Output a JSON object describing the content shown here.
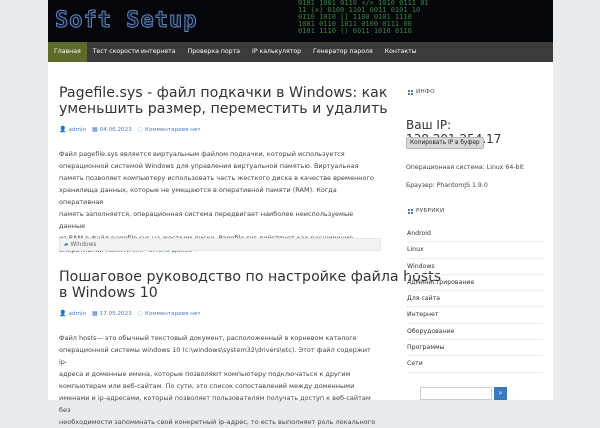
{
  "site": {
    "logo_text": "Soft Setup"
  },
  "nav": {
    "items": [
      "Главная",
      "Тест скорости интернета",
      "Проверка порта",
      "IP калькулятор",
      "Генератор пароля",
      "Контакты"
    ]
  },
  "posts": [
    {
      "title_line1": "Pagefile.sys - файл подкачки в Windows: как",
      "title_line2": "уменьшить размер, переместить и удалить",
      "author": "admin",
      "date": "04.06.2023",
      "comments": "Комментариев нет",
      "lines": [
        "Файл pagefile.sys является виртуальным файлом подкачки, который используется",
        "операционной системой Windows для управления виртуальной памятью. Виртуальная",
        "память позволяет компьютеру использовать часть жесткого диска в качестве временного",
        "хранилища данных, которые не умещаются в оперативной памяти (RAM). Когда оперативная",
        "память заполняется, операционная система передвигает наиболее неиспользуемые данные",
        "из RAM в файл pagefile.sys на жестком диске. Pagefile.sys действует как расширение",
        "оперативной памяти и…"
      ],
      "read_more": "Читать далее »",
      "category": "Windows"
    },
    {
      "title_line1": "Пошаговое руководство по настройке файла hosts",
      "title_line2": "в Windows 10",
      "author": "admin",
      "date": "17.05.2023",
      "comments": "Комментариев нет",
      "lines": [
        "Файл hosts— это обычный текстовый документ, расположенный в корневом каталоге",
        "операционной системы windows 10 (c:\\windows\\system32\\drivers\\etc). Этот файл содержит ip-",
        "адреса и доменные имена, которые позволяют компьютеру подключаться к другим",
        "компьютерам или веб-сайтам. По сути, это список сопоставлений между доменными",
        "именами и ip-адресами, который позволяет пользователям получать доступ к веб-сайтам без",
        "необходимости запоминать свой конкретный ip-адрес, то есть выполняет роль локального"
      ]
    }
  ],
  "sidebar": {
    "info_title": "ИНФО",
    "ip_label": "Ваш IP: 138.201.254.17",
    "copy_button": "Копировать IP в буфер",
    "os": "Операционная система: Linux 64-bit",
    "browser": "Браузер: PhantomJS 1.9.0",
    "rubrics_title": "РУБРИКИ",
    "rubrics": [
      "Android",
      "Linux",
      "Windows",
      "Администрирование",
      "Для сайта",
      "Интернет",
      "Оборудование",
      "Программы",
      "Сети"
    ]
  },
  "colors": {
    "nav_bg": "#3b3b3b",
    "nav_active": "#5d6b2a",
    "accent": "#4a7bbd"
  }
}
